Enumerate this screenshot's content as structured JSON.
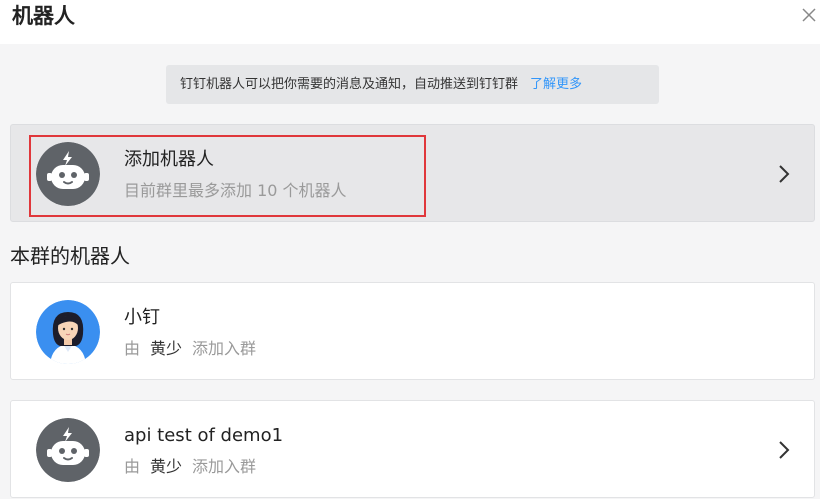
{
  "dialog": {
    "title": "机器人",
    "close_icon": "close-icon"
  },
  "notice": {
    "text": "钉钉机器人可以把你需要的消息及通知，自动推送到钉钉群",
    "link": "了解更多"
  },
  "add_robot": {
    "title": "添加机器人",
    "subtitle": "目前群里最多添加 10 个机器人",
    "icon": "robot-icon"
  },
  "section": {
    "title": "本群的机器人"
  },
  "robots": [
    {
      "name": "小钉",
      "by": "由",
      "owner": "黄少",
      "action": "添加入群",
      "icon": "person-avatar-icon"
    },
    {
      "name": "api test of demo1",
      "by": "由",
      "owner": "黄少",
      "action": "添加入群",
      "icon": "robot-icon"
    }
  ],
  "colors": {
    "link": "#3296fa",
    "highlight": "#e0373b",
    "robot_avatar_bg": "#5f6368",
    "person_avatar_bg": "#3a8ff0"
  }
}
